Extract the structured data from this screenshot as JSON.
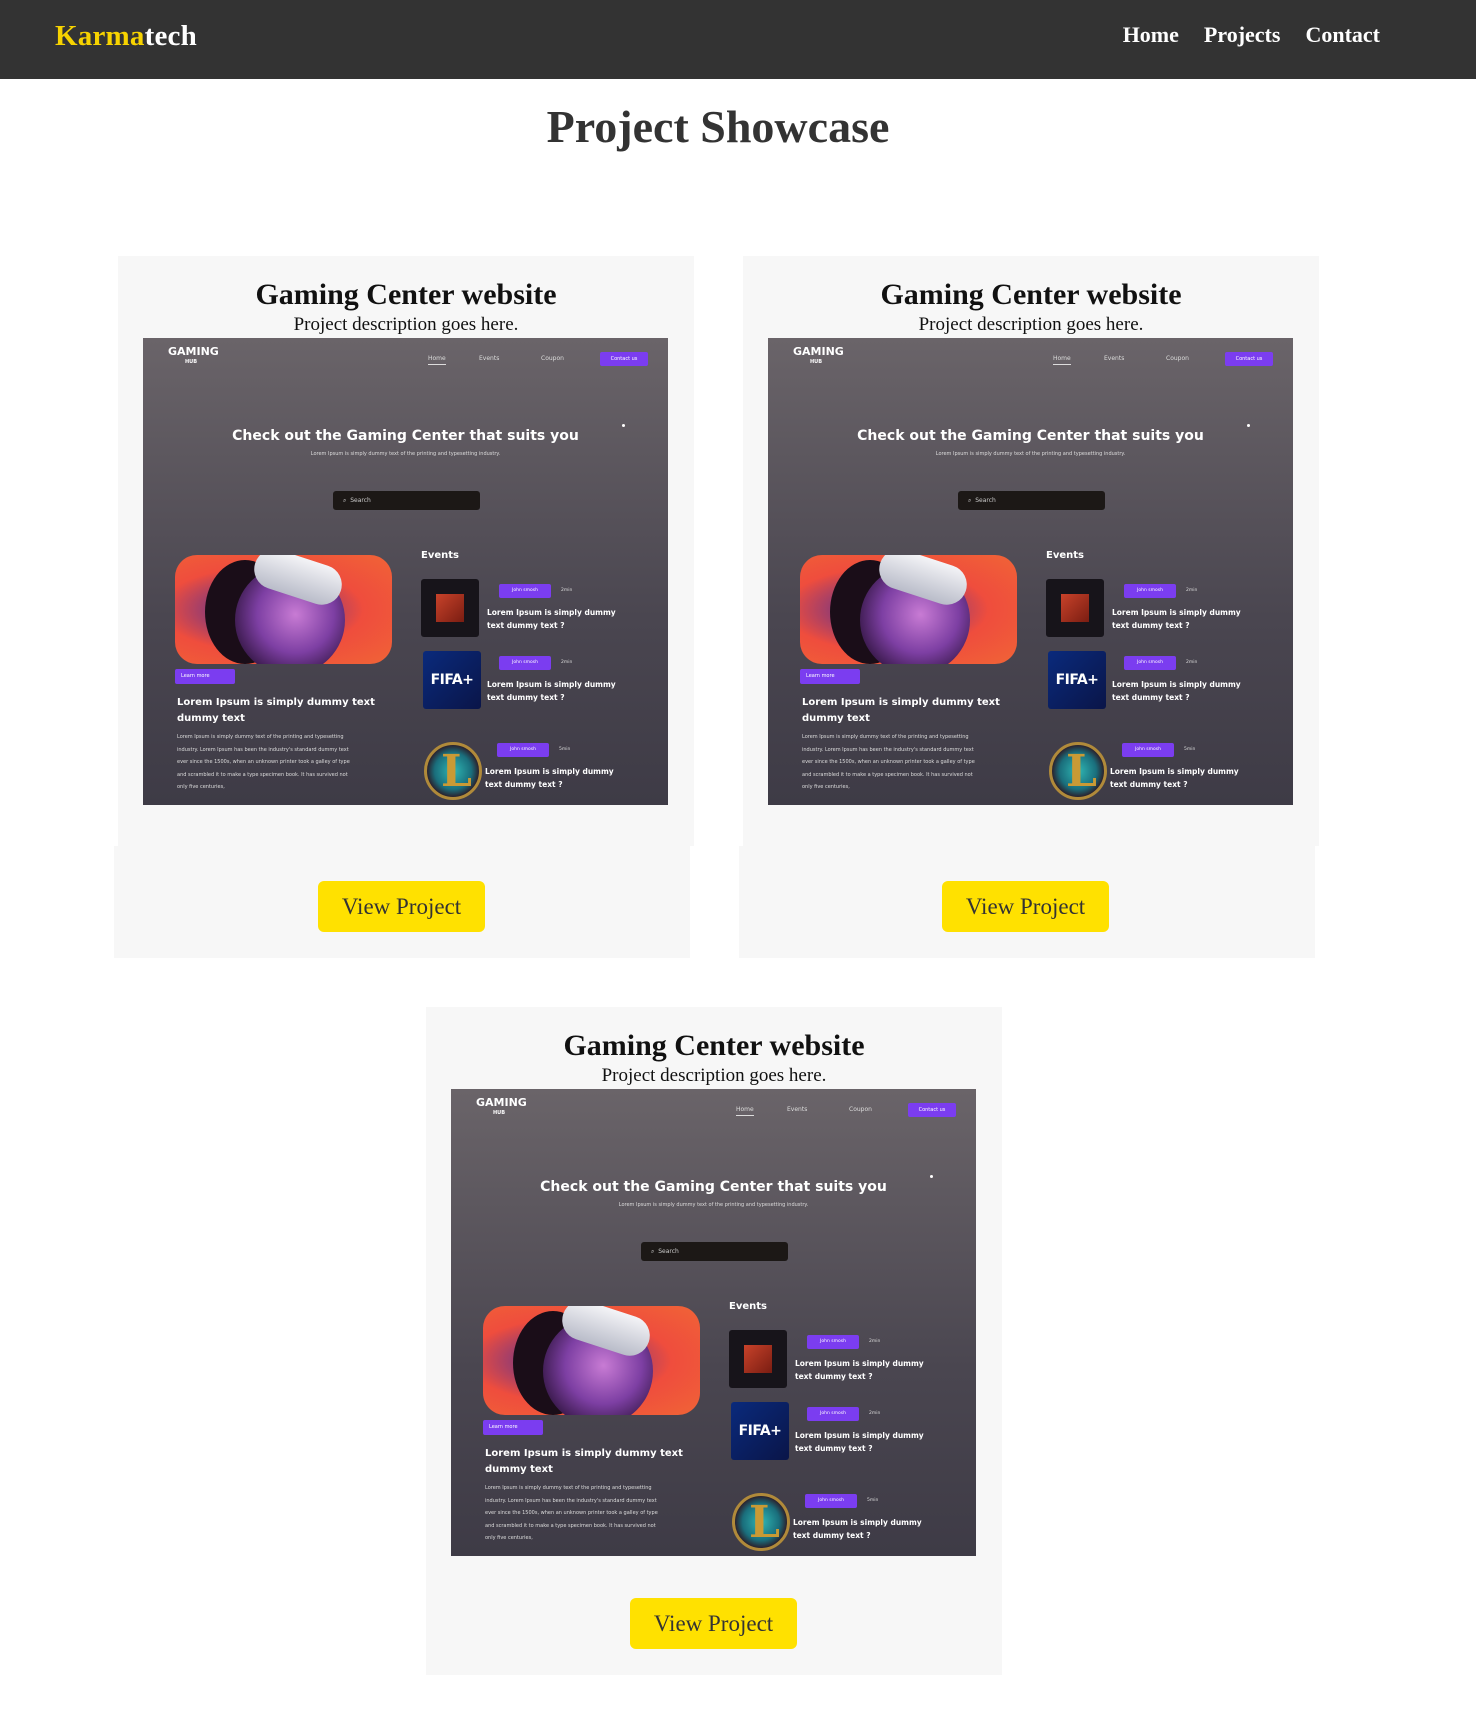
{
  "nav": {
    "brand_highlight": "Karma",
    "brand_rest": "tech",
    "links": [
      "Home",
      "Projects",
      "Contact"
    ]
  },
  "page_title": "Project Showcase",
  "projects": [
    {
      "title": "Gaming Center website",
      "description": "Project description goes here.",
      "button": "View Project"
    },
    {
      "title": "Gaming Center website",
      "description": "Project description goes here.",
      "button": "View Project"
    },
    {
      "title": "Gaming Center website",
      "description": "Project description goes here.",
      "button": "View Project"
    }
  ],
  "preview": {
    "logo": "GAMING",
    "logo_sub": "HUB",
    "nav": [
      "Home",
      "Events",
      "Coupon"
    ],
    "contact": "Contact us",
    "heading": "Check out the Gaming Center that suits you",
    "subheading": "Lorem Ipsum is simply dummy text of the printing and typesetting industry.",
    "search_placeholder": "Search",
    "learn_more": "Learn more",
    "lorem_title": "Lorem Ipsum is simply dummy text dummy text",
    "lorem_body": "Lorem Ipsum is simply dummy text of the printing and typesetting industry. Lorem Ipsum has been the industry's standard dummy text ever since the 1500s, when an unknown printer took a galley of type and scrambled it to make a type specimen book. It has survived not only five centuries,",
    "events_label": "Events",
    "events": [
      {
        "tag": "John smosh",
        "time": "2min",
        "text": "Lorem Ipsum is simply dummy text dummy text ?"
      },
      {
        "tag": "John smosh",
        "time": "2min",
        "text": "Lorem Ipsum is simply dummy text dummy text ?",
        "icon_text": "FIFA+"
      },
      {
        "tag": "John smosh",
        "time": "5min",
        "text": "Lorem Ipsum is simply dummy text dummy text ?",
        "icon_text": "L"
      }
    ]
  },
  "colors": {
    "navbar": "#333333",
    "brand_highlight": "#f7d300",
    "button": "#ffe100",
    "card_bg": "#f7f7f7",
    "preview_accent": "#7b3df0"
  }
}
